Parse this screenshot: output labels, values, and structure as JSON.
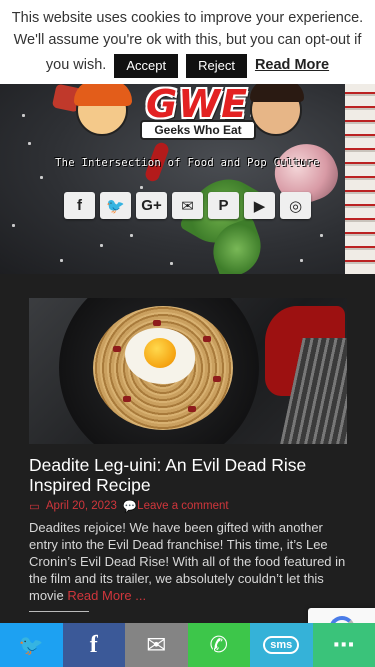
{
  "cookie": {
    "line1": "This website uses cookies to improve your experience.",
    "line2": "We'll assume you're ok with this, but you can opt-out if",
    "line3": "you wish.",
    "accept_label": "Accept",
    "reject_label": "Reject",
    "read_more_label": "Read More"
  },
  "site": {
    "logo_text": "GWE",
    "logo_banner": "Geeks Who Eat",
    "tagline": "The Intersection of Food and Pop Culture"
  },
  "socials": [
    {
      "name": "facebook-icon",
      "glyph": "f"
    },
    {
      "name": "twitter-icon",
      "glyph": "🐦"
    },
    {
      "name": "google-plus-icon",
      "glyph": "G+"
    },
    {
      "name": "email-icon",
      "glyph": "✉"
    },
    {
      "name": "pinterest-icon",
      "glyph": "P"
    },
    {
      "name": "youtube-icon",
      "glyph": "▶"
    },
    {
      "name": "instagram-icon",
      "glyph": "◎"
    }
  ],
  "post": {
    "title": "Deadite Leg-uini: An Evil Dead Rise Inspired Recipe",
    "date": "April 20, 2023",
    "comment_link": "Leave a comment",
    "excerpt": "Deadites rejoice! We have been gifted with another entry into the Evil Dead franchise! This time, it’s Lee Cronin’s Evil Dead Rise! With all of the food featured in the film and its trailer, we absolutely couldn’t let this movie",
    "read_more": "Read More ..."
  },
  "share_bar": [
    {
      "name": "share-twitter-button",
      "icon": "twitter-icon",
      "glyph": "🐦",
      "color": "#1da1f2"
    },
    {
      "name": "share-facebook-button",
      "icon": "facebook-icon",
      "glyph": "f",
      "color": "#3b5998"
    },
    {
      "name": "share-email-button",
      "icon": "email-icon",
      "glyph": "✉",
      "color": "#848484"
    },
    {
      "name": "share-whatsapp-button",
      "icon": "whatsapp-icon",
      "glyph": "✆",
      "color": "#3dc64a"
    },
    {
      "name": "share-sms-button",
      "icon": "sms-icon",
      "glyph": "sms",
      "color": "#35b2d8"
    },
    {
      "name": "share-more-button",
      "icon": "more-icon",
      "glyph": "⋯",
      "color": "#3ac37a"
    }
  ],
  "colors": {
    "accent": "#d0363c",
    "background": "#1f1f1f"
  }
}
